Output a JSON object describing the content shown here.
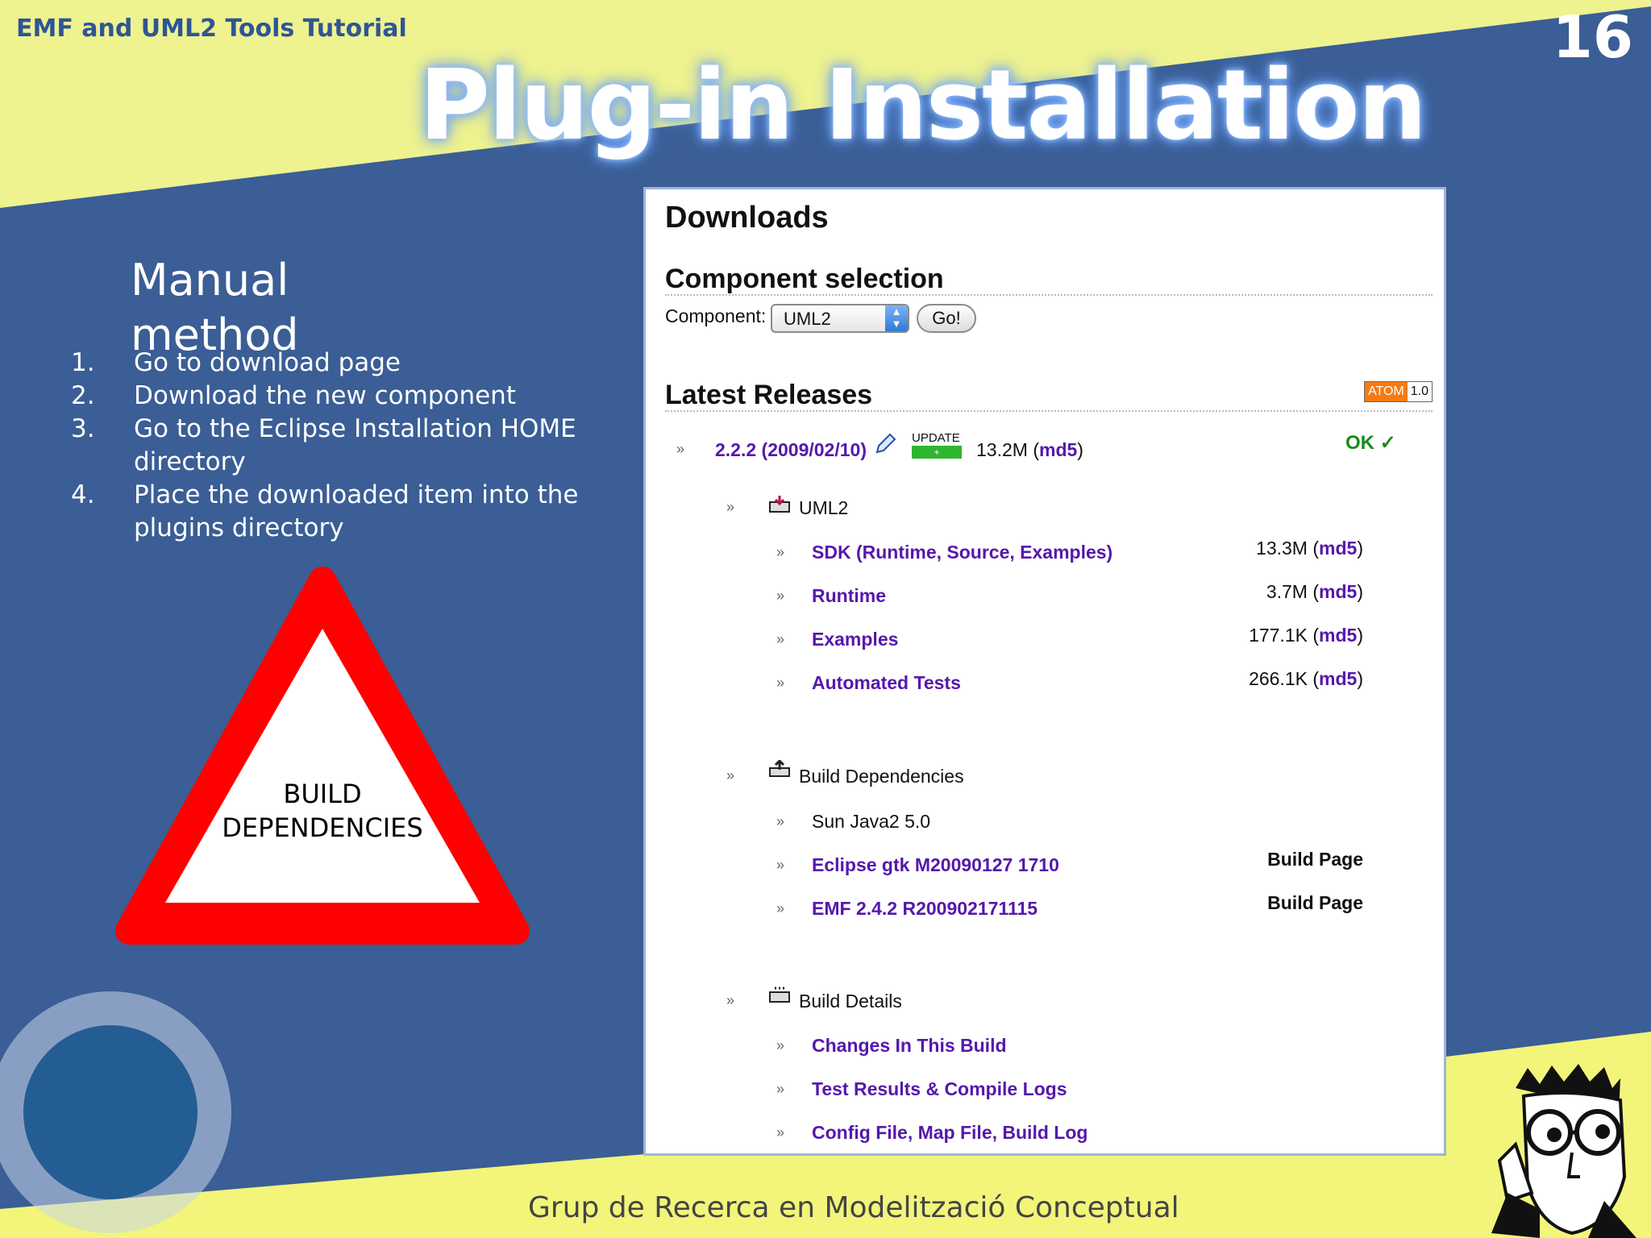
{
  "slide": {
    "header_label": "EMF and UML2 Tools Tutorial",
    "page_number": "16",
    "title": "Plug-in Installation",
    "footer": "Grup de Recerca en Modelització Conceptual"
  },
  "left": {
    "heading": "Manual method",
    "steps": [
      {
        "num": "1.",
        "text": "Go to download page"
      },
      {
        "num": "2.",
        "text": "Download the new component"
      },
      {
        "num": "3.",
        "text": "Go to the Eclipse Installation HOME directory"
      },
      {
        "num": "4.",
        "text": "Place the downloaded item into the plugins directory"
      }
    ],
    "warning_line1": "BUILD",
    "warning_line2": "DEPENDENCIES"
  },
  "downloads": {
    "title": "Downloads",
    "component_selection": "Component selection",
    "component_label": "Component:",
    "component_value": "UML2",
    "go_label": "Go!",
    "latest_releases": "Latest Releases",
    "atom_a": "ATOM",
    "atom_b": "1.0",
    "release": {
      "version_link": "2.2.2 (2009/02/10)",
      "update_label": "UPDATE",
      "size": "13.2M",
      "md5": "md5",
      "status": "OK ✓"
    },
    "uml2": {
      "label": "UML2",
      "items": [
        {
          "label": "SDK (Runtime, Source, Examples)",
          "size": "13.3M",
          "md5": "md5"
        },
        {
          "label": "Runtime",
          "size": "3.7M",
          "md5": "md5"
        },
        {
          "label": "Examples",
          "size": "177.1K",
          "md5": "md5"
        },
        {
          "label": "Automated Tests",
          "size": "266.1K",
          "md5": "md5"
        }
      ]
    },
    "build_dependencies": {
      "label": "Build Dependencies",
      "items": [
        {
          "label": "Sun Java2 5.0",
          "link": ""
        },
        {
          "label": "Eclipse gtk M20090127 1710",
          "link": "Build Page"
        },
        {
          "label": "EMF 2.4.2 R200902171115",
          "link": "Build Page"
        }
      ]
    },
    "build_details": {
      "label": "Build Details",
      "items": [
        {
          "label": "Changes In This Build"
        },
        {
          "label": "Test Results & Compile Logs"
        },
        {
          "label": "Config File, Map File, Build Log"
        }
      ]
    }
  },
  "colors": {
    "background_blue": "#3a5e95",
    "yellow_band": "#eef28f",
    "warning_red": "#ff0000",
    "link_purple": "#5518ab"
  }
}
